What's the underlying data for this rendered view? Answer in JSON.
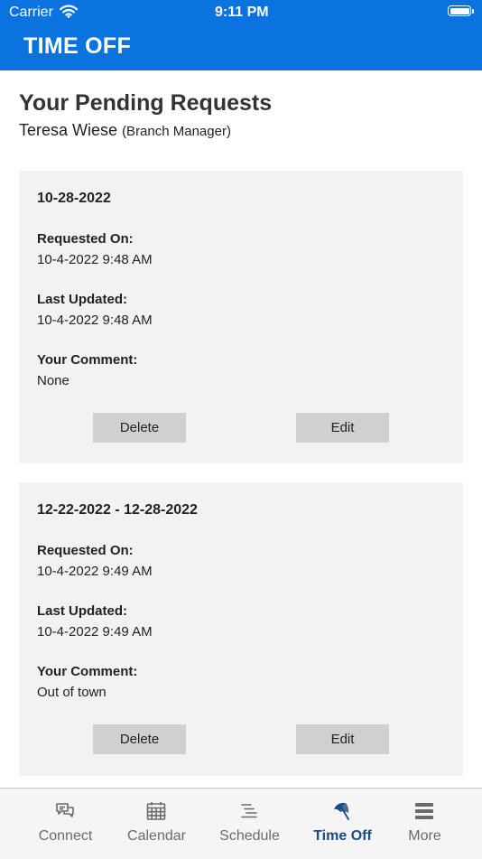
{
  "status_bar": {
    "carrier": "Carrier",
    "time": "9:11 PM"
  },
  "header": {
    "title": "TIME OFF"
  },
  "page": {
    "title": "Your Pending Requests",
    "user_name": "Teresa Wiese",
    "user_role": "(Branch Manager)"
  },
  "labels": {
    "requested_on": "Requested On:",
    "last_updated": "Last Updated:",
    "your_comment": "Your Comment:",
    "delete": "Delete",
    "edit": "Edit"
  },
  "requests": [
    {
      "date": "10-28-2022",
      "requested_on": "10-4-2022 9:48 AM",
      "last_updated": "10-4-2022 9:48 AM",
      "comment": "None"
    },
    {
      "date": "12-22-2022 - 12-28-2022",
      "requested_on": "10-4-2022 9:49 AM",
      "last_updated": "10-4-2022 9:49 AM",
      "comment": "Out of town"
    }
  ],
  "tabs": [
    {
      "label": "Connect",
      "icon": "chat-bubbles-icon"
    },
    {
      "label": "Calendar",
      "icon": "calendar-icon"
    },
    {
      "label": "Schedule",
      "icon": "schedule-lines-icon"
    },
    {
      "label": "Time Off",
      "icon": "beach-umbrella-icon",
      "active": true
    },
    {
      "label": "More",
      "icon": "menu-bars-icon"
    }
  ],
  "colors": {
    "header": "#0b73e0",
    "card": "#f2f2f2",
    "button": "#d0d0d0",
    "active_tab": "#1a4a86",
    "inactive_tab": "#6b6b6b"
  }
}
